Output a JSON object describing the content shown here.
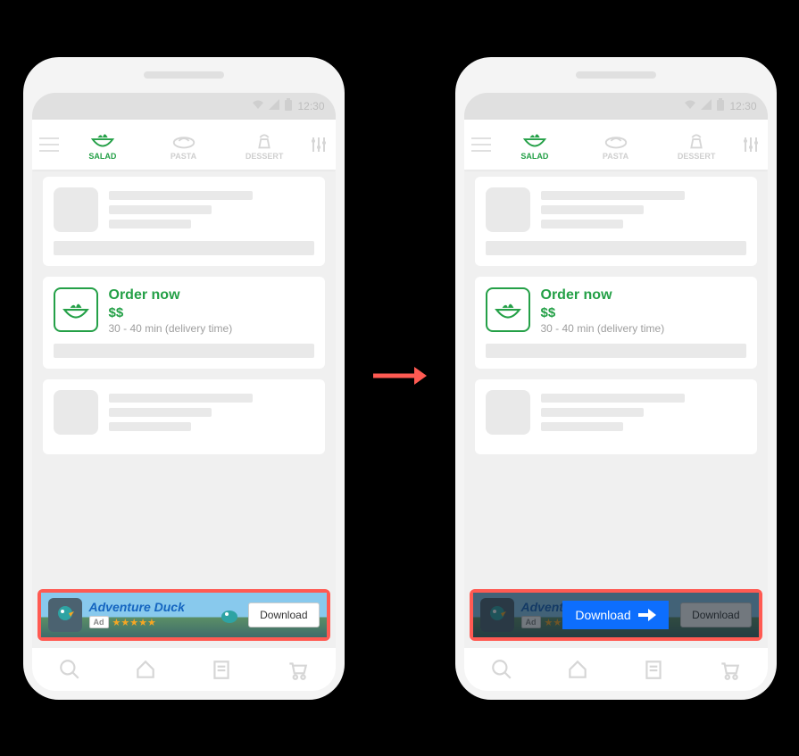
{
  "status_time": "12:30",
  "tabs": {
    "salad": "SALAD",
    "pasta": "PASTA",
    "dessert": "DESSERT"
  },
  "featured": {
    "title": "Order now",
    "price": "$$",
    "subtitle": "30 - 40 min (delivery time)"
  },
  "ad": {
    "app_name": "Adventure Duck",
    "badge": "Ad",
    "stars": 5,
    "cta": "Download",
    "overlay_cta": "Download"
  },
  "colors": {
    "accent": "#24a047",
    "highlight": "#ff5a52",
    "overlay_button": "#0d6efd",
    "ad_title": "#1565c0"
  }
}
